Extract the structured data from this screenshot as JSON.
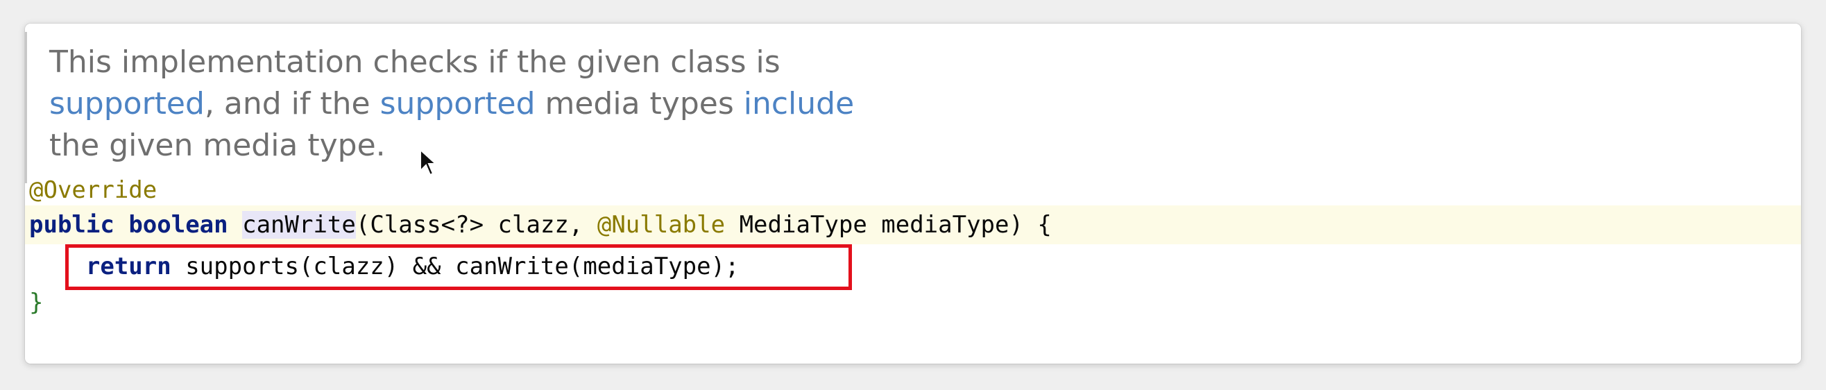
{
  "doc": {
    "line1": "This implementation checks if the given class is",
    "line2_link1": "supported",
    "line2_text1": ", and if the ",
    "line2_link2": "supported",
    "line2_text2": " media types ",
    "line2_link3": "include",
    "line3": "the given media type."
  },
  "code": {
    "annotation": "@Override",
    "kw_public": "public",
    "kw_boolean": "boolean",
    "method_name": "canWrite",
    "sig_rest1": "(Class<?> clazz, ",
    "nullable": "@Nullable",
    "sig_rest2": " MediaType mediaType) {",
    "kw_return": "return",
    "body_rest": " supports(clazz) && canWrite(mediaType);",
    "closing": "}"
  },
  "colors": {
    "link": "#4d83c4",
    "keyword": "#0a2080",
    "annotation": "#8a7a00",
    "highlight_box": "#e3101c"
  }
}
